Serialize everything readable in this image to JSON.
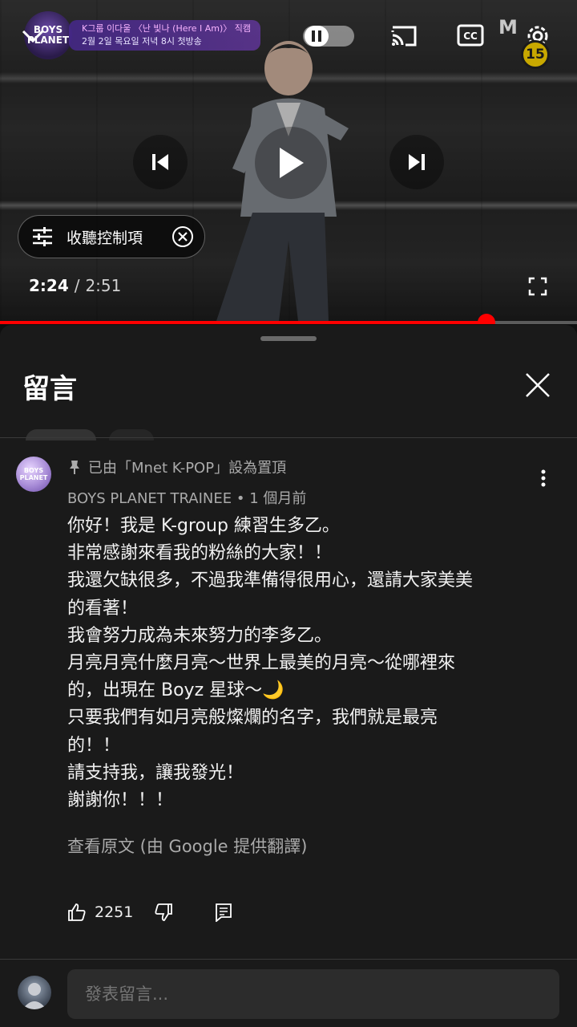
{
  "player": {
    "banner_logo": "BOYS PLANET",
    "banner_line1": "K그룹 이다울 〈난 빛나 (Here I Am)〉 직캠",
    "banner_line2": "2월 2일 목요일 저녁 8시 첫방송",
    "channel_logo": "M",
    "rating_badge": "15",
    "listen_controls_label": "收聽控制項",
    "time_current": "2:24",
    "time_separator": "/",
    "time_duration": "2:51",
    "progress_fraction": 0.843,
    "icons": [
      "chevron-down-icon",
      "pause-icon",
      "cast-icon",
      "cc-icon",
      "settings-icon",
      "previous-icon",
      "play-icon",
      "next-icon",
      "sliders-icon",
      "close-circle-icon",
      "fullscreen-icon"
    ],
    "accent_color": "#ff0000"
  },
  "comments_panel": {
    "title": "留言",
    "pinned_comment": {
      "avatar_text": "BOYS PLANET",
      "pinned_label": "已由「Mnet K-POP」設為置頂",
      "author": "BOYS PLANET TRAINEE",
      "meta_separator": "•",
      "time_ago": "1 個月前",
      "body_lines": [
        "你好！我是 K-group 練習生多乙。",
        "非常感謝來看我的粉絲的大家！！",
        "我還欠缺很多，不過我準備得很用心，還請大家美美",
        "的看著！",
        "我會努力成為未來努力的李多乙。",
        "月亮月亮什麼月亮～世界上最美的月亮～從哪裡來",
        "的，出現在 Boyz 星球～🌙",
        "只要我們有如月亮般燦爛的名字，我們就是最亮",
        "的！！",
        "請支持我，讓我發光！",
        "謝謝你！！！"
      ],
      "translation_note": "查看原文 (由 Google 提供翻譯)",
      "like_count": "2251"
    },
    "input_placeholder": "發表留言..."
  }
}
